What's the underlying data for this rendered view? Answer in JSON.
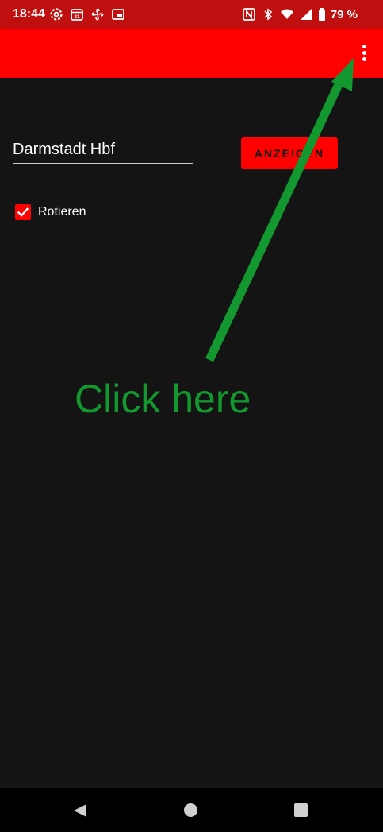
{
  "status_bar": {
    "time": "18:44",
    "battery_percent_text": "79 %",
    "icons": [
      "settings-gear-icon",
      "calendar-icon",
      "fan-icon",
      "cast-icon",
      "nfc-icon",
      "bluetooth-icon",
      "wifi-icon",
      "signal-icon",
      "battery-icon"
    ]
  },
  "app_bar": {
    "color": "#ff0000",
    "overflow_menu_icon": "more-vert-icon"
  },
  "form": {
    "station_value": "Darmstadt Hbf",
    "show_button_label": "ANZEIGEN",
    "rotate_label": "Rotieren",
    "rotate_checked": true
  },
  "annotation": {
    "text": "Click here",
    "color": "#12982f"
  },
  "nav_bar": {
    "buttons": [
      "back-icon",
      "home-icon",
      "recents-icon"
    ]
  }
}
